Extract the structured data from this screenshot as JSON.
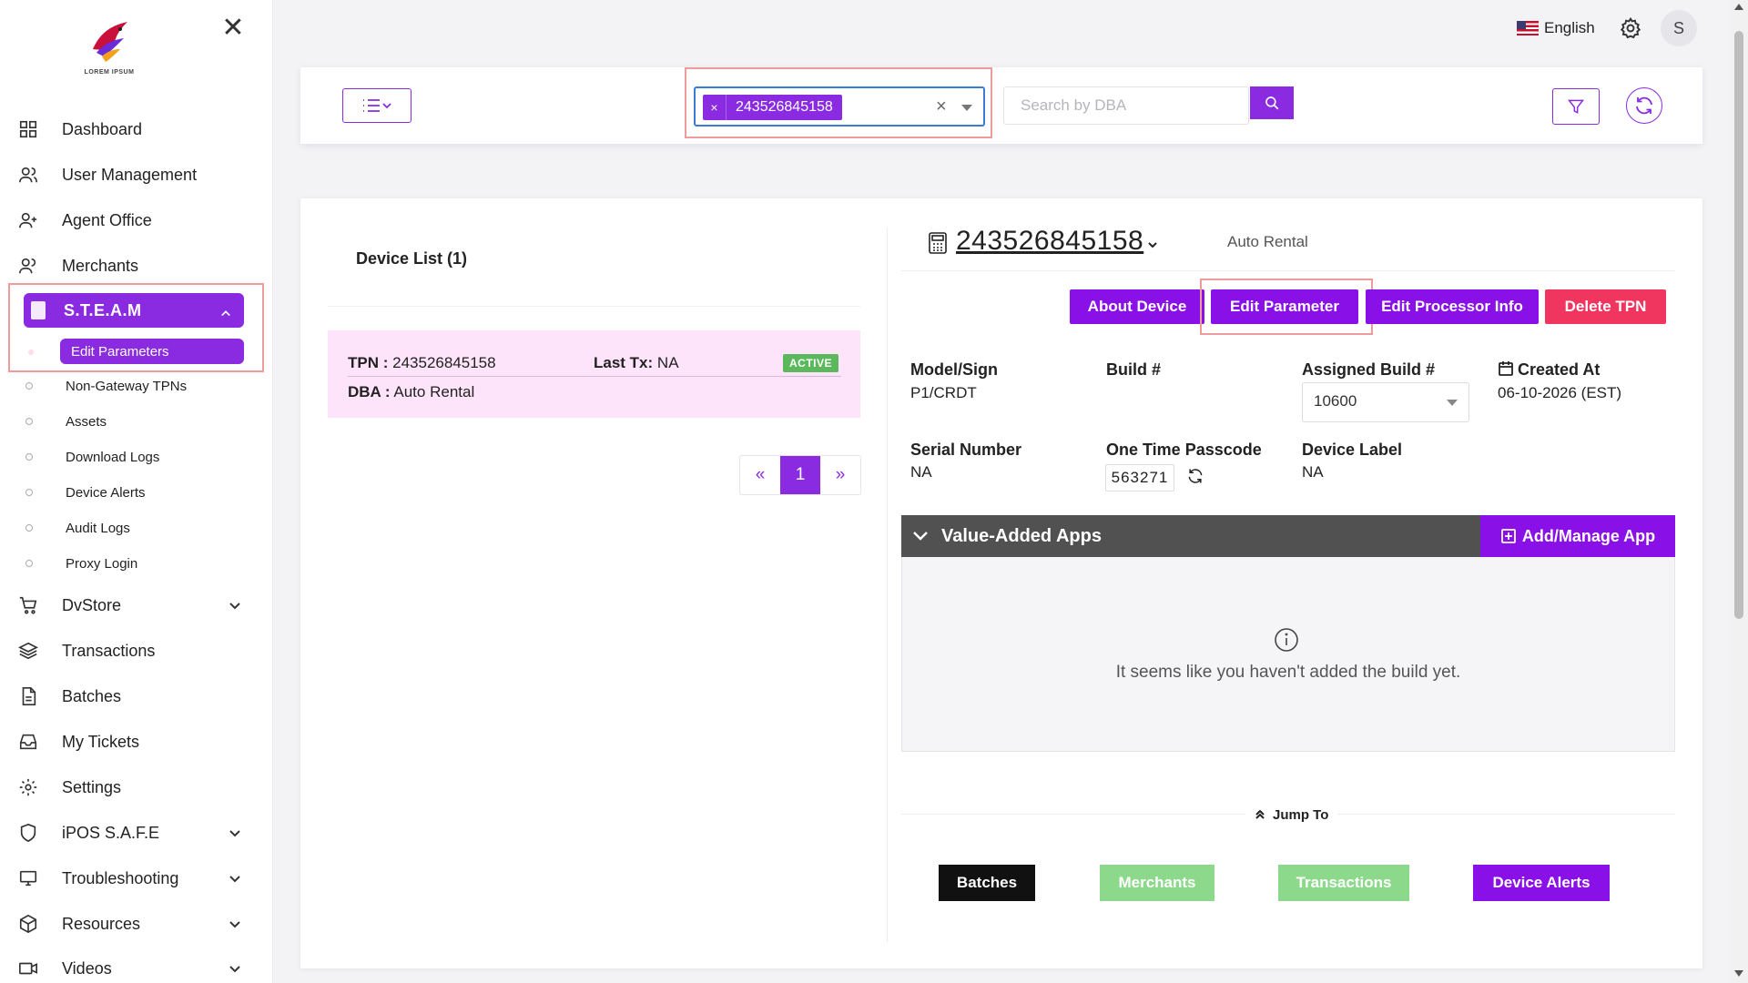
{
  "sidebar": {
    "logo_text": "LOREM IPSUM",
    "nav": [
      {
        "label": "Dashboard",
        "icon": "dashboard-grid-icon"
      },
      {
        "label": "User Management",
        "icon": "users-icon"
      },
      {
        "label": "Agent Office",
        "icon": "user-plus-icon"
      },
      {
        "label": "Merchants",
        "icon": "merchants-icon"
      }
    ],
    "steam": {
      "label": "S.T.E.A.M",
      "active_sub": "Edit Parameters",
      "subs": [
        "Non-Gateway TPNs",
        "Assets",
        "Download Logs",
        "Device Alerts",
        "Audit Logs",
        "Proxy Login"
      ]
    },
    "nav2": [
      {
        "label": "DvStore",
        "icon": "cart-icon",
        "expandable": true
      },
      {
        "label": "Transactions",
        "icon": "layers-icon",
        "expandable": false
      },
      {
        "label": "Batches",
        "icon": "document-icon",
        "expandable": false
      },
      {
        "label": "My Tickets",
        "icon": "inbox-icon",
        "expandable": false
      },
      {
        "label": "Settings",
        "icon": "gear-icon",
        "expandable": false
      },
      {
        "label": "iPOS S.A.F.E",
        "icon": "shield-icon",
        "expandable": true
      },
      {
        "label": "Troubleshooting",
        "icon": "monitor-icon",
        "expandable": true
      },
      {
        "label": "Resources",
        "icon": "box-icon",
        "expandable": true
      },
      {
        "label": "Videos",
        "icon": "video-icon",
        "expandable": true
      }
    ]
  },
  "topbar": {
    "language": "English",
    "avatar_initial": "S"
  },
  "search": {
    "selected_tpn": "243526845158",
    "dba_placeholder": "Search by DBA"
  },
  "device_list": {
    "title": "Device List (1)",
    "rows": [
      {
        "tpn_label": "TPN :",
        "tpn": "243526845158",
        "last_tx_label": "Last Tx:",
        "last_tx": "NA",
        "status": "ACTIVE",
        "dba_label": "DBA :",
        "dba": "Auto Rental"
      }
    ],
    "pager": {
      "prev": "«",
      "current": "1",
      "next": "»"
    }
  },
  "device": {
    "tpn": "243526845158",
    "dba": "Auto Rental",
    "buttons": {
      "about": "About Device",
      "edit_param": "Edit Parameter",
      "edit_proc": "Edit Processor Info",
      "delete": "Delete TPN"
    },
    "fields": {
      "model_label": "Model/Sign",
      "model_value": "P1/CRDT",
      "build_label": "Build #",
      "build_value": "",
      "assigned_label": "Assigned Build #",
      "assigned_value": "10600",
      "created_label": "Created At",
      "created_value": "06-10-2026 (EST)",
      "serial_label": "Serial Number",
      "serial_value": "NA",
      "otp_label": "One Time Passcode",
      "otp_value": "563271",
      "label_label": "Device Label",
      "label_value": "NA"
    },
    "apps": {
      "title": "Value-Added Apps",
      "add_label": "Add/Manage App",
      "empty_message": "It seems like you haven't added the build yet."
    },
    "jump": {
      "label": "Jump To",
      "buttons": [
        "Batches",
        "Merchants",
        "Transactions",
        "Device Alerts"
      ]
    }
  },
  "colors": {
    "accent": "#8a2be2",
    "danger": "#f0355e",
    "success": "#5cb85c",
    "highlight": "#f09b9b"
  }
}
